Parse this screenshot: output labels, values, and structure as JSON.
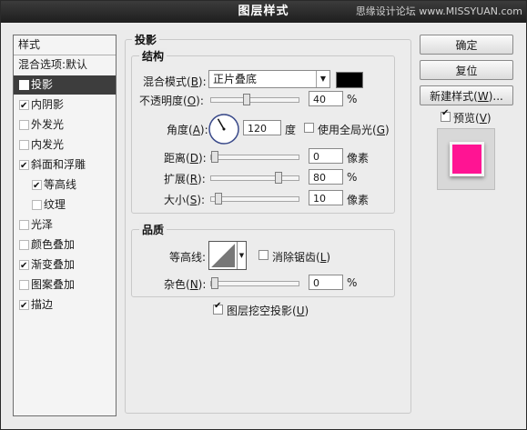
{
  "window": {
    "title": "图层样式",
    "watermark": "思缘设计论坛 www.MISSYUAN.com"
  },
  "style_list": {
    "items": [
      {
        "label": "样式",
        "checkbox": false,
        "checked": false,
        "indent": false,
        "selected": false
      },
      {
        "label": "混合选项:默认",
        "checkbox": false,
        "checked": false,
        "indent": false,
        "selected": false
      },
      {
        "label": "投影",
        "checkbox": true,
        "checked": true,
        "indent": false,
        "selected": true
      },
      {
        "label": "内阴影",
        "checkbox": true,
        "checked": true,
        "indent": false,
        "selected": false
      },
      {
        "label": "外发光",
        "checkbox": true,
        "checked": false,
        "indent": false,
        "selected": false
      },
      {
        "label": "内发光",
        "checkbox": true,
        "checked": false,
        "indent": false,
        "selected": false
      },
      {
        "label": "斜面和浮雕",
        "checkbox": true,
        "checked": true,
        "indent": false,
        "selected": false
      },
      {
        "label": "等高线",
        "checkbox": true,
        "checked": true,
        "indent": true,
        "selected": false
      },
      {
        "label": "纹理",
        "checkbox": true,
        "checked": false,
        "indent": true,
        "selected": false
      },
      {
        "label": "光泽",
        "checkbox": true,
        "checked": false,
        "indent": false,
        "selected": false
      },
      {
        "label": "颜色叠加",
        "checkbox": true,
        "checked": false,
        "indent": false,
        "selected": false
      },
      {
        "label": "渐变叠加",
        "checkbox": true,
        "checked": true,
        "indent": false,
        "selected": false
      },
      {
        "label": "图案叠加",
        "checkbox": true,
        "checked": false,
        "indent": false,
        "selected": false
      },
      {
        "label": "描边",
        "checkbox": true,
        "checked": true,
        "indent": false,
        "selected": false
      }
    ]
  },
  "drop_shadow": {
    "section_title": "投影",
    "structure": {
      "title": "结构",
      "blend_mode_label": "混合模式(B):",
      "blend_mode_label_pre": "混合模式(",
      "blend_mode_label_key": "B",
      "blend_mode_label_post": "):",
      "blend_mode_value": "正片叠底",
      "shadow_color": "#000000",
      "opacity_label_pre": "不透明度(",
      "opacity_label_key": "O",
      "opacity_label_post": "):",
      "opacity_value": "40",
      "opacity_unit": "%",
      "opacity_level": 0.4,
      "angle_label_pre": "角度(",
      "angle_label_key": "A",
      "angle_label_post": "):",
      "angle_value": "120",
      "angle_unit": "度",
      "angle_degrees": 120,
      "global_light_label_pre": "使用全局光(",
      "global_light_label_key": "G",
      "global_light_label_post": ")",
      "global_light_checked": false,
      "distance_label_pre": "距离(",
      "distance_label_key": "D",
      "distance_label_post": "):",
      "distance_value": "0",
      "distance_unit": "像素",
      "distance_level": 0.0,
      "spread_label_pre": "扩展(",
      "spread_label_key": "R",
      "spread_label_post": "):",
      "spread_value": "80",
      "spread_unit": "%",
      "spread_level": 0.8,
      "size_label_pre": "大小(",
      "size_label_key": "S",
      "size_label_post": "):",
      "size_value": "10",
      "size_unit": "像素",
      "size_level": 0.04
    },
    "quality": {
      "title": "品质",
      "contour_label": "等高线:",
      "antialias_label_pre": "消除锯齿(",
      "antialias_label_key": "L",
      "antialias_label_post": ")",
      "antialias_checked": false,
      "noise_label_pre": "杂色(",
      "noise_label_key": "N",
      "noise_label_post": "):",
      "noise_value": "0",
      "noise_unit": "%",
      "noise_level": 0.0
    },
    "knockout_label_pre": "图层挖空投影(",
    "knockout_label_key": "U",
    "knockout_label_post": ")",
    "knockout_checked": true
  },
  "buttons": {
    "ok": "确定",
    "reset": "复位",
    "new_style_pre": "新建样式(",
    "new_style_key": "W",
    "new_style_post": ")...",
    "preview_pre": "预览(",
    "preview_key": "V",
    "preview_post": ")",
    "preview_checked": true
  },
  "colors": {
    "preview_swatch": "#ff1493",
    "selected_bg": "#3d3d3d",
    "title_bar": "#1e1e1e"
  }
}
